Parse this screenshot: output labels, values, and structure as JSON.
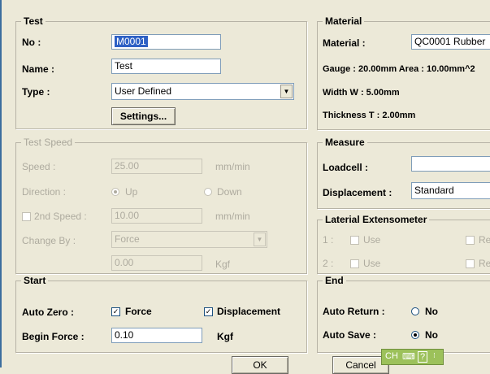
{
  "test_group": {
    "legend": "Test",
    "no_label": "No :",
    "no_value": "M0001",
    "name_label": "Name :",
    "name_value": "Test",
    "type_label": "Type :",
    "type_value": "User Defined",
    "settings_button": "Settings..."
  },
  "speed_group": {
    "legend": "Test Speed",
    "speed_label": "Speed :",
    "speed_value": "25.00",
    "speed_unit": "mm/min",
    "direction_label": "Direction :",
    "direction_up": "Up",
    "direction_down": "Down",
    "second_speed_label": "2nd Speed :",
    "second_speed_value": "10.00",
    "second_speed_unit": "mm/min",
    "change_by_label": "Change By :",
    "change_by_value": "Force",
    "change_value": "0.00",
    "change_unit": "Kgf"
  },
  "start_group": {
    "legend": "Start",
    "auto_zero_label": "Auto Zero :",
    "force_check": "Force",
    "displacement_check": "Displacement",
    "begin_force_label": "Begin Force :",
    "begin_force_value": "0.10",
    "begin_force_unit": "Kgf"
  },
  "material_group": {
    "legend": "Material",
    "material_label": "Material :",
    "material_value": "QC0001 Rubber",
    "gauge_area": "Gauge : 20.00mm   Area : 10.00mm^2",
    "width": "Width W : 5.00mm",
    "thickness": "Thickness T : 2.00mm"
  },
  "measure_group": {
    "legend": "Measure",
    "loadcell_label": "Loadcell :",
    "loadcell_value": "",
    "displacement_label": "Displacement :",
    "displacement_value": "Standard"
  },
  "extensometer_group": {
    "legend": "Laterial Extensometer",
    "row1_index": "1 :",
    "row2_index": "2 :",
    "use_label": "Use",
    "right_label": "Re"
  },
  "end_group": {
    "legend": "End",
    "auto_return_label": "Auto Return :",
    "auto_return_value": "No",
    "auto_save_label": "Auto Save :",
    "auto_save_value": "No"
  },
  "buttons": {
    "ok": "OK",
    "cancel": "Cancel"
  },
  "ime_bar": {
    "lang": "CH",
    "help": "?"
  },
  "colors": {
    "window": "#ece9d8",
    "field_border": "#7f9db9",
    "selection": "#2d60c4",
    "ime": "#9cc15a"
  }
}
